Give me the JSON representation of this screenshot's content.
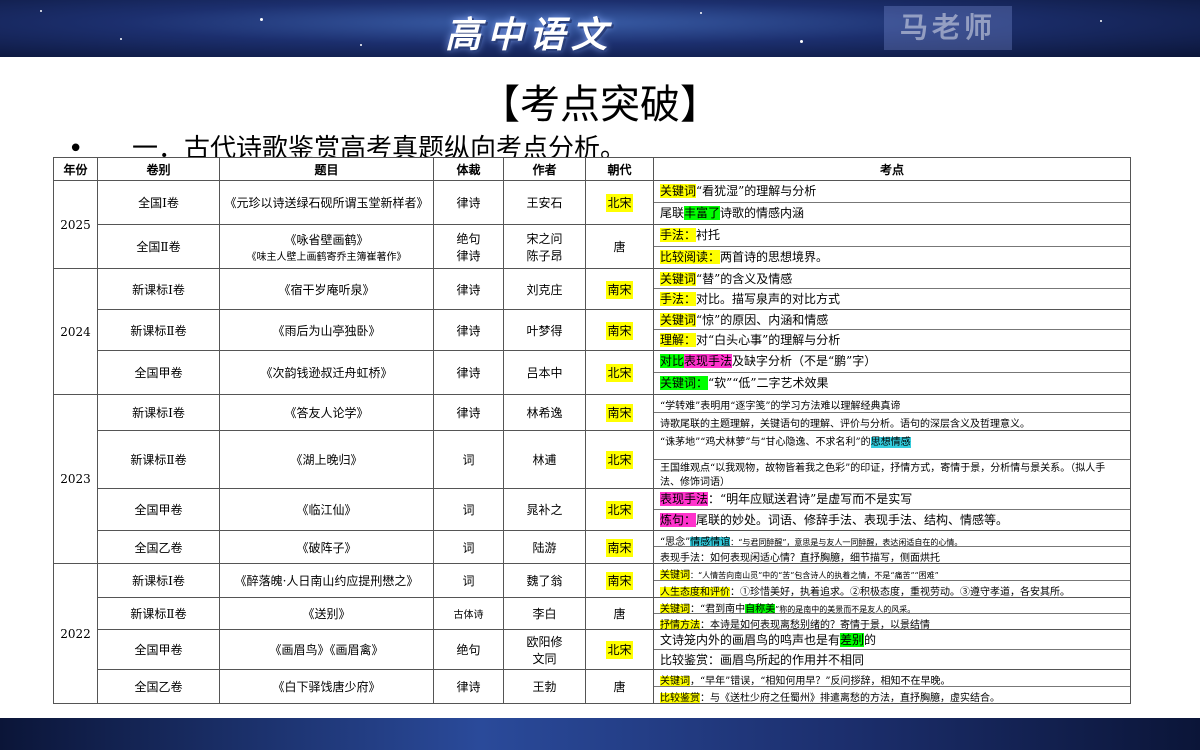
{
  "banner": {
    "title": "高中语文",
    "teacher": "马老师"
  },
  "main_title": "【考点突破】",
  "subtitle": {
    "bullet": "•",
    "text": "一．古代诗歌鉴赏高考真题纵向考点分析。"
  },
  "table": {
    "headers": [
      "年份",
      "卷别",
      "题目",
      "体裁",
      "作者",
      "朝代",
      "考点"
    ],
    "rows": [
      {
        "year": "2025",
        "paper": "全国Ⅰ卷",
        "title": "《元珍以诗送绿石砚所谓玉堂新样者》",
        "genre": "律诗",
        "author": "王安石",
        "dynasty": "北宋",
        "dyn_hl": true,
        "points": [
          [
            {
              "t": "关键词",
              "h": "y"
            },
            {
              "t": "“看犹湿”的理解与分析"
            }
          ],
          [
            {
              "t": "尾联"
            },
            {
              "t": "丰富了",
              "h": "g"
            },
            {
              "t": "诗歌的情感内涵"
            }
          ]
        ]
      },
      {
        "paper": "全国Ⅱ卷",
        "title": "《咏省壁画鹤》",
        "title2": "《味主人壁上画鹤寄乔主簿崔著作》",
        "genre": "绝句",
        "genre2": "律诗",
        "author": "宋之问",
        "author2": "陈子昂",
        "dynasty": "唐",
        "dyn_hl": false,
        "points": [
          [
            {
              "t": "手法：",
              "h": "y"
            },
            {
              "t": "衬托"
            }
          ],
          [
            {
              "t": "比较阅读：",
              "h": "y"
            },
            {
              "t": "两首诗的思想境界。"
            }
          ]
        ]
      },
      {
        "year": "2024",
        "paper": "新课标Ⅰ卷",
        "title": "《宿干岁庵听泉》",
        "genre": "律诗",
        "author": "刘克庄",
        "dynasty": "南宋",
        "dyn_hl": true,
        "points": [
          [
            {
              "t": "关键词",
              "h": "y"
            },
            {
              "t": "“替”的含义及情感"
            }
          ],
          [
            {
              "t": "手法：",
              "h": "y"
            },
            {
              "t": "对比。描写泉声的对比方式"
            }
          ]
        ]
      },
      {
        "paper": "新课标Ⅱ卷",
        "title": "《雨后为山亭独卧》",
        "genre": "律诗",
        "author": "叶梦得",
        "dynasty": "南宋",
        "dyn_hl": true,
        "points": [
          [
            {
              "t": "关键词",
              "h": "y"
            },
            {
              "t": "“惊”的原因、内涵和情感"
            }
          ],
          [
            {
              "t": "理解：",
              "h": "y"
            },
            {
              "t": "对“白头心事”的理解与分析"
            }
          ]
        ]
      },
      {
        "paper": "全国甲卷",
        "title": "《次韵钱逊叔迁舟虹桥》",
        "genre": "律诗",
        "author": "吕本中",
        "dynasty": "北宋",
        "dyn_hl": true,
        "points": [
          [
            {
              "t": "对比",
              "h": "g"
            },
            {
              "t": "表现手法",
              "h": "m"
            },
            {
              "t": "及缺字分析（不是“鹏”字）"
            }
          ],
          [
            {
              "t": "关键词：",
              "h": "g"
            },
            {
              "t": "“软”“低”二字艺术效果"
            }
          ]
        ]
      },
      {
        "year": "2023",
        "paper": "新课标Ⅰ卷",
        "title": "《答友人论学》",
        "genre": "律诗",
        "author": "林希逸",
        "dynasty": "南宋",
        "dyn_hl": true,
        "points": [
          [
            {
              "t": "“学转难”表明用“逐字笺”的学习方法难以理解经典真谛",
              "c": "small"
            }
          ],
          [
            {
              "t": "诗歌尾联的主题理解，关键语句的理解、评价与分析。语句的深层含义及哲理意义。",
              "c": "small"
            }
          ]
        ]
      },
      {
        "paper": "新课标Ⅱ卷",
        "title": "《湖上晚归》",
        "genre": "词",
        "author": "林逋",
        "dynasty": "北宋",
        "dyn_hl": true,
        "points": [
          [
            {
              "t": "“诛茅地”“鸡犬林萝”与“甘心隐逸、不求名利”的",
              "c": "small"
            },
            {
              "t": "思想情感",
              "h": "c",
              "c": "small"
            }
          ],
          [
            {
              "t": "王国维观点“以我观物，故物皆着我之色彩”的印证，抒情方式，寄情于景，分析情与景关系。（拟人手法、修饰词语）",
              "c": "small"
            }
          ]
        ]
      },
      {
        "paper": "全国甲卷",
        "title": "《临江仙》",
        "genre": "词",
        "author": "晁补之",
        "dynasty": "北宋",
        "dyn_hl": true,
        "points": [
          [
            {
              "t": "表现手法",
              "h": "m"
            },
            {
              "t": "：“明年应赋送君诗”是虚写而不是实写"
            }
          ],
          [
            {
              "t": "炼句：",
              "h": "m"
            },
            {
              "t": "尾联的妙处。词语、修辞手法、表现手法、结构、情感等。"
            }
          ]
        ]
      },
      {
        "paper": "全国乙卷",
        "title": "《破阵子》",
        "genre": "词",
        "author": "陆游",
        "dynasty": "南宋",
        "dyn_hl": true,
        "points": [
          [
            {
              "t": "“思念”",
              "c": "small"
            },
            {
              "t": "情感情谊",
              "h": "c",
              "c": "small"
            },
            {
              "t": "：“与君同醉醒”，意思是与友人一同醉醒，表达闲适自在的心情。",
              "c": "tiny"
            }
          ],
          [
            {
              "t": "表现手法：如何表现闲适心情？直抒胸臆，细节描写，侧面烘托",
              "c": "small"
            }
          ]
        ]
      },
      {
        "year": "2022",
        "paper": "新课标Ⅰ卷",
        "title": "《醉落魄·人日南山约应提刑懋之》",
        "genre": "词",
        "author": "魏了翁",
        "dynasty": "南宋",
        "dyn_hl": true,
        "points": [
          [
            {
              "t": "关键词",
              "h": "y",
              "c": "small"
            },
            {
              "t": "：“人情苦向南山觅”中的“苦”包含诗人的执着之情，不是“痛苦”“困难”",
              "c": "tiny"
            }
          ],
          [
            {
              "t": "人生态度和评价",
              "h": "y",
              "c": "small"
            },
            {
              "t": "：①珍惜美好，执着追求。②积极态度，重视劳动。③遵守孝道，各安其所。",
              "c": "small"
            }
          ]
        ]
      },
      {
        "paper": "新课标Ⅱ卷",
        "title": "《送别》",
        "genre": "古体诗",
        "author": "李白",
        "dynasty": "唐",
        "dyn_hl": false,
        "points": [
          [
            {
              "t": "关键词",
              "h": "y",
              "c": "small"
            },
            {
              "t": "：“君到南中",
              "c": "small"
            },
            {
              "t": "自称美",
              "h": "g",
              "c": "small"
            },
            {
              "t": "”称的是南中的美景而不是友人的风采。",
              "c": "tiny"
            }
          ],
          [
            {
              "t": "抒情方法",
              "h": "y",
              "c": "small"
            },
            {
              "t": "：本诗是如何表现离愁别绪的？寄情于景，以景结情",
              "c": "small"
            }
          ]
        ]
      },
      {
        "paper": "全国甲卷",
        "title": "《画眉鸟》《画眉禽》",
        "genre": "绝句",
        "author": "欧阳修",
        "author2": "文同",
        "dynasty": "北宋",
        "dyn_hl": true,
        "points": [
          [
            {
              "t": "文诗笼内外的画眉鸟的鸣声也是有"
            },
            {
              "t": "差别",
              "h": "g"
            },
            {
              "t": "的"
            }
          ],
          [
            {
              "t": "比较鉴赏：画眉鸟所起的作用并不相同"
            }
          ]
        ]
      },
      {
        "paper": "全国乙卷",
        "title": "《白下驿饯唐少府》",
        "genre": "律诗",
        "author": "王勃",
        "dynasty": "唐",
        "dyn_hl": false,
        "points": [
          [
            {
              "t": "关键词",
              "h": "y",
              "c": "small"
            },
            {
              "t": "，“早年”错误，“相知何用早？”反问拶辞，相知不在早晚。",
              "c": "small"
            }
          ],
          [
            {
              "t": "比较鉴赏",
              "h": "y",
              "c": "small"
            },
            {
              "t": "：与《送杜少府之任蜀州》排遣离愁的方法，直抒胸臆，虚实结合。",
              "c": "small"
            }
          ]
        ]
      }
    ]
  }
}
